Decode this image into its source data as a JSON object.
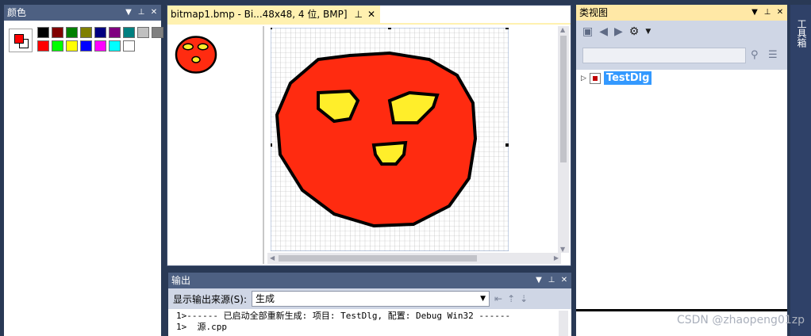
{
  "palette": {
    "title": "颜色",
    "colors": [
      "#000000",
      "#800000",
      "#008000",
      "#808000",
      "#000080",
      "#800080",
      "#008080",
      "#c0c0c0",
      "#808080",
      "#ff0000",
      "#00ff00",
      "#ffff00",
      "#0000ff",
      "#ff00ff",
      "#00ffff",
      "#ffffff"
    ],
    "fg": "#ff0000",
    "bg": "#ffffff"
  },
  "editor": {
    "tab_title": "bitmap1.bmp - Bi...48x48, 4 位, BMP]",
    "pixel_colors": {
      "red": "#ff2b10",
      "yellow": "#ffee2a",
      "black": "#000000"
    }
  },
  "classview": {
    "title": "类视图",
    "search_placeholder": "",
    "tree": [
      {
        "label": "TestDlg"
      }
    ]
  },
  "toolbox": {
    "title": "工具箱"
  },
  "output": {
    "title": "输出",
    "source_label": "显示输出来源(S):",
    "source_value": "生成",
    "lines": [
      "1>------ 已启动全部重新生成: 项目: TestDlg, 配置: Debug Win32 ------",
      "1>  源.cpp"
    ]
  },
  "watermark": "CSDN @zhaopeng01zp"
}
